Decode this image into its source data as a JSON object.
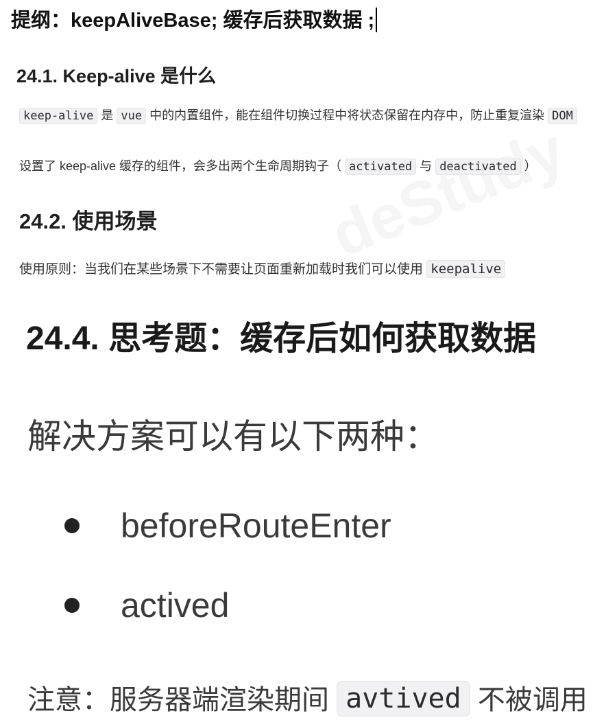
{
  "outline": {
    "title": "提纲：keepAliveBase; 缓存后获取数据 ;"
  },
  "section_1": {
    "heading": "24.1. Keep-alive 是什么",
    "line1": {
      "code_a": "keep-alive",
      "t1": " 是 ",
      "code_b": "vue",
      "t2": " 中的内置组件，能在组件切换过程中将状态保留在内存中，防止重复渲染 ",
      "code_c": "DOM"
    },
    "line2": {
      "t1": "设置了 keep-alive 缓存的组件，会多出两个生命周期钩子（ ",
      "code_a": "activated",
      "t2": " 与 ",
      "code_b": "deactivated",
      "t3": " ）"
    }
  },
  "section_2": {
    "heading": "24.2. 使用场景",
    "line1": {
      "t1": "使用原则：当我们在某些场景下不需要让页面重新加载时我们可以使用 ",
      "code_a": "keepalive"
    }
  },
  "section_4": {
    "heading": "24.4. 思考题：缓存后如何获取数据",
    "intro": "解决方案可以有以下两种：",
    "bullets": [
      "beforeRouteEnter",
      "actived"
    ],
    "note": {
      "t1": "注意：服务器端渲染期间 ",
      "code_a": "avtived",
      "t2": " 不被调用"
    }
  }
}
